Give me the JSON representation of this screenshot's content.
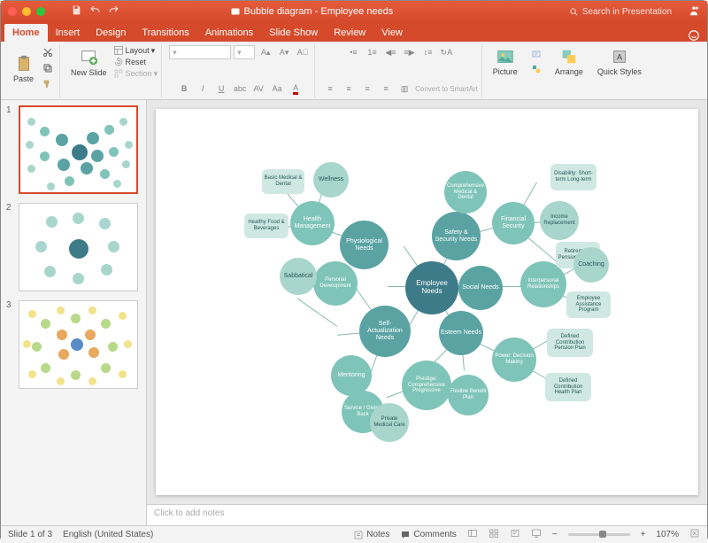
{
  "window": {
    "title": "Bubble diagram - Employee needs"
  },
  "search": {
    "placeholder": "Search in Presentation"
  },
  "tabs": [
    "Home",
    "Insert",
    "Design",
    "Transitions",
    "Animations",
    "Slide Show",
    "Review",
    "View"
  ],
  "active_tab": "Home",
  "ribbon": {
    "paste": "Paste",
    "new_slide": "New Slide",
    "layout": "Layout",
    "reset": "Reset",
    "section": "Section",
    "convert": "Convert to SmartArt",
    "picture": "Picture",
    "arrange": "Arrange",
    "quick_styles": "Quick Styles"
  },
  "thumbs": {
    "count": 3
  },
  "notes_placeholder": "Click to add notes",
  "status": {
    "slide_info": "Slide 1 of 3",
    "language": "English (United States)",
    "notes": "Notes",
    "comments": "Comments",
    "zoom": "107%"
  },
  "chart_data": {
    "type": "bubble-diagram",
    "center": "Employee Needs",
    "branches": [
      {
        "label": "Physiological Needs",
        "children": [
          {
            "label": "Health Management",
            "leaves": [
              "Basic Medical & Dental",
              "Wellness",
              "Healthy Food & Beverages"
            ]
          }
        ]
      },
      {
        "label": "Safety & Security Needs",
        "children": [
          {
            "label": "Comprehensive Medical & Dental",
            "leaves": []
          },
          {
            "label": "Financial Security",
            "leaves": [
              "Disability: Short-term Long-term",
              "Income Replacement",
              "Retirement: Pension Savings"
            ]
          }
        ]
      },
      {
        "label": "Social Needs",
        "children": [
          {
            "label": "Interpersonal Relationships",
            "leaves": [
              "Coaching",
              "Employee Assistance Program"
            ]
          }
        ]
      },
      {
        "label": "Esteem Needs",
        "children": [
          {
            "label": "Power: Decision Making",
            "leaves": [
              "Defined Contribution Pension Plan",
              "Defined Contribution Health Plan"
            ]
          },
          {
            "label": "Flexible Benefit Plan",
            "leaves": []
          },
          {
            "label": "Prestige: Comprehensive Progressive",
            "leaves": [
              "Private Medical Care"
            ]
          }
        ]
      },
      {
        "label": "Self-Actualization Needs",
        "children": [
          {
            "label": "Personal Development",
            "leaves": [
              "Sabbatical"
            ]
          },
          {
            "label": "Mentoring",
            "leaves": []
          },
          {
            "label": "Service / Giving Back",
            "leaves": []
          }
        ]
      }
    ]
  }
}
